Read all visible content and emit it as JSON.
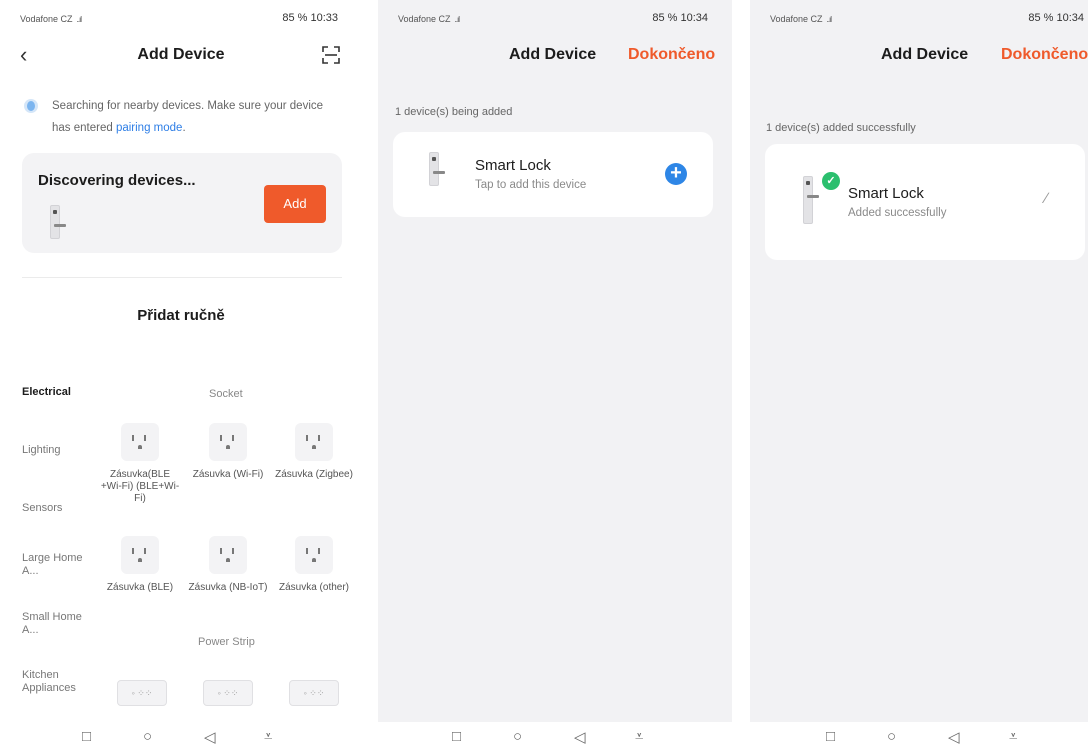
{
  "colors": {
    "accent": "#ef5a2b",
    "link": "#2e7ee6",
    "success": "#2bbf6e",
    "add_icon": "#2e86e6"
  },
  "panels": [
    {
      "status": {
        "carrier": "Vodafone CZ",
        "signal": "..ıl",
        "right": "85 % 10:33"
      },
      "title": "Add Device",
      "back_icon": "chevron-left-icon",
      "scan_icon": "scan-icon",
      "tip_text": "Searching for nearby devices. Make sure your device has entered",
      "tip_link": "pairing mode",
      "tip_end": ".",
      "discover": {
        "title": "Discovering devices...",
        "add_label": "Add",
        "device_icon": "smart-lock-icon"
      },
      "manual_title": "Přidat ručně",
      "categories": [
        "Electrical",
        "Lighting",
        "Sensors",
        "Large Home A...",
        "Small Home A...",
        "Kitchen Appliances"
      ],
      "groups": {
        "socket": "Socket",
        "power_strip": "Power Strip"
      },
      "products": [
        {
          "label": "Zásuvka(BLE +Wi-Fi) (BLE+Wi-Fi)"
        },
        {
          "label": "Zásuvka (Wi-Fi)"
        },
        {
          "label": "Zásuvka (Zigbee)"
        },
        {
          "label": "Zásuvka (BLE)"
        },
        {
          "label": "Zásuvka (NB-IoT)"
        },
        {
          "label": "Zásuvka (other)"
        }
      ]
    },
    {
      "status": {
        "carrier": "Vodafone CZ",
        "signal": "..ıl",
        "right": "85 % 10:34"
      },
      "title": "Add Device",
      "done_label": "Dokončeno",
      "subtitle": "1 device(s) being added",
      "device": {
        "name": "Smart Lock",
        "desc": "Tap to add this device",
        "icon": "smart-lock-icon",
        "action_icon": "plus-icon"
      }
    },
    {
      "status": {
        "carrier": "Vodafone CZ",
        "signal": "..ıl",
        "right": "85 % 10:34"
      },
      "title": "Add Device",
      "done_label": "Dokončeno",
      "subtitle": "1 device(s) added successfully",
      "device": {
        "name": "Smart Lock",
        "desc": "Added successfully",
        "icon": "smart-lock-icon",
        "status_icon": "check-icon",
        "action_icon": "edit-icon"
      }
    }
  ],
  "navbar": {
    "square": "□",
    "circle": "○",
    "back": "◁",
    "menu": "⩡"
  }
}
